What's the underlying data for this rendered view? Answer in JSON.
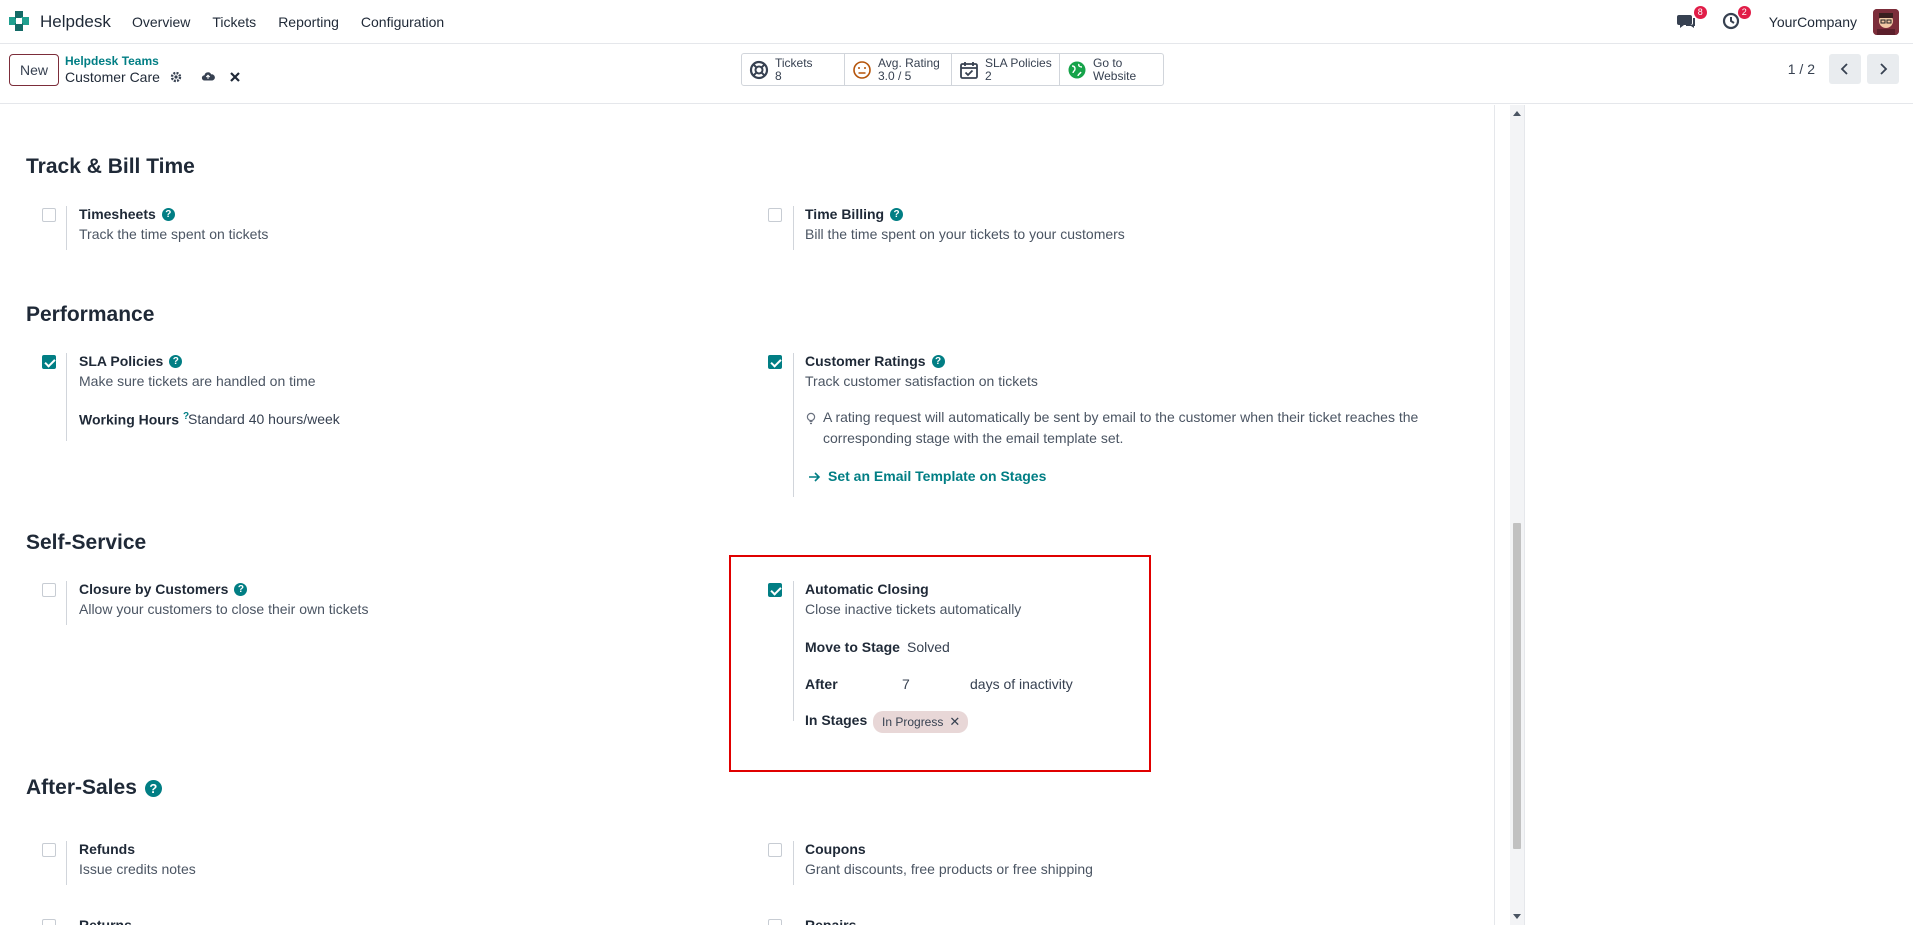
{
  "navbar": {
    "app_name": "Helpdesk",
    "menu": [
      "Overview",
      "Tickets",
      "Reporting",
      "Configuration"
    ],
    "messages_count": "8",
    "activities_count": "2",
    "company": "YourCompany"
  },
  "control_panel": {
    "new_label": "New",
    "breadcrumb_parent": "Helpdesk Teams",
    "breadcrumb_current": "Customer Care",
    "stats": {
      "tickets_label": "Tickets",
      "tickets_value": "8",
      "rating_label": "Avg. Rating",
      "rating_value": "3.0 / 5",
      "sla_label": "SLA Policies",
      "sla_value": "2",
      "website_label_1": "Go to",
      "website_label_2": "Website"
    },
    "pager": "1 / 2"
  },
  "sections": {
    "track_bill": {
      "title": "Track & Bill Time",
      "timesheets_title": "Timesheets",
      "timesheets_desc": "Track the time spent on tickets",
      "time_billing_title": "Time Billing",
      "time_billing_desc": "Bill the time spent on your tickets to your customers"
    },
    "performance": {
      "title": "Performance",
      "sla_title": "SLA Policies",
      "sla_desc": "Make sure tickets are handled on time",
      "working_hours_label": "Working Hours",
      "working_hours_sup": "?",
      "working_hours_value": "Standard 40 hours/week",
      "ratings_title": "Customer Ratings",
      "ratings_desc": "Track customer satisfaction on tickets",
      "ratings_hint_1": "A rating request will automatically be sent by email to the customer when their ticket reaches the",
      "ratings_hint_2": "corresponding stage with the email template set.",
      "ratings_link": "Set an Email Template on Stages"
    },
    "self_service": {
      "title": "Self-Service",
      "closure_title": "Closure by Customers",
      "closure_desc": "Allow your customers to close their own tickets",
      "auto_title": "Automatic Closing",
      "auto_desc": "Close inactive tickets automatically",
      "move_label": "Move to Stage",
      "move_value": "Solved",
      "after_label": "After",
      "after_value": "7",
      "after_suffix": "days of inactivity",
      "stages_label": "In Stages",
      "stages_tag": "In Progress"
    },
    "after_sales": {
      "title": "After-Sales",
      "refunds_title": "Refunds",
      "refunds_desc": "Issue credits notes",
      "coupons_title": "Coupons",
      "coupons_desc": "Grant discounts, free products or free shipping",
      "returns_title": "Returns",
      "repairs_title": "Repairs"
    }
  },
  "colors": {
    "accent": "#017e84",
    "brand": "#7c2d3a",
    "highlight": "#e00000"
  }
}
